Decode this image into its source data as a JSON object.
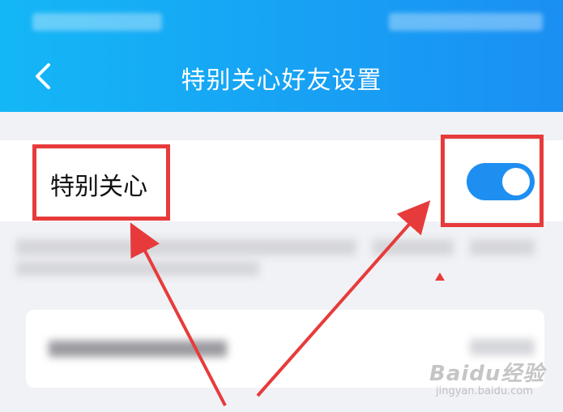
{
  "header": {
    "title": "特别关心好友设置",
    "back_icon": "chevron-left-icon"
  },
  "setting": {
    "label": "特别关心",
    "toggle_on": true
  },
  "watermark": {
    "brand": "Baidu经验",
    "url": "jingyan.baidu.com"
  },
  "colors": {
    "header_start": "#14b7f6",
    "header_end": "#1a8ff3",
    "toggle": "#1e8ff1",
    "highlight": "#e73b3b"
  }
}
